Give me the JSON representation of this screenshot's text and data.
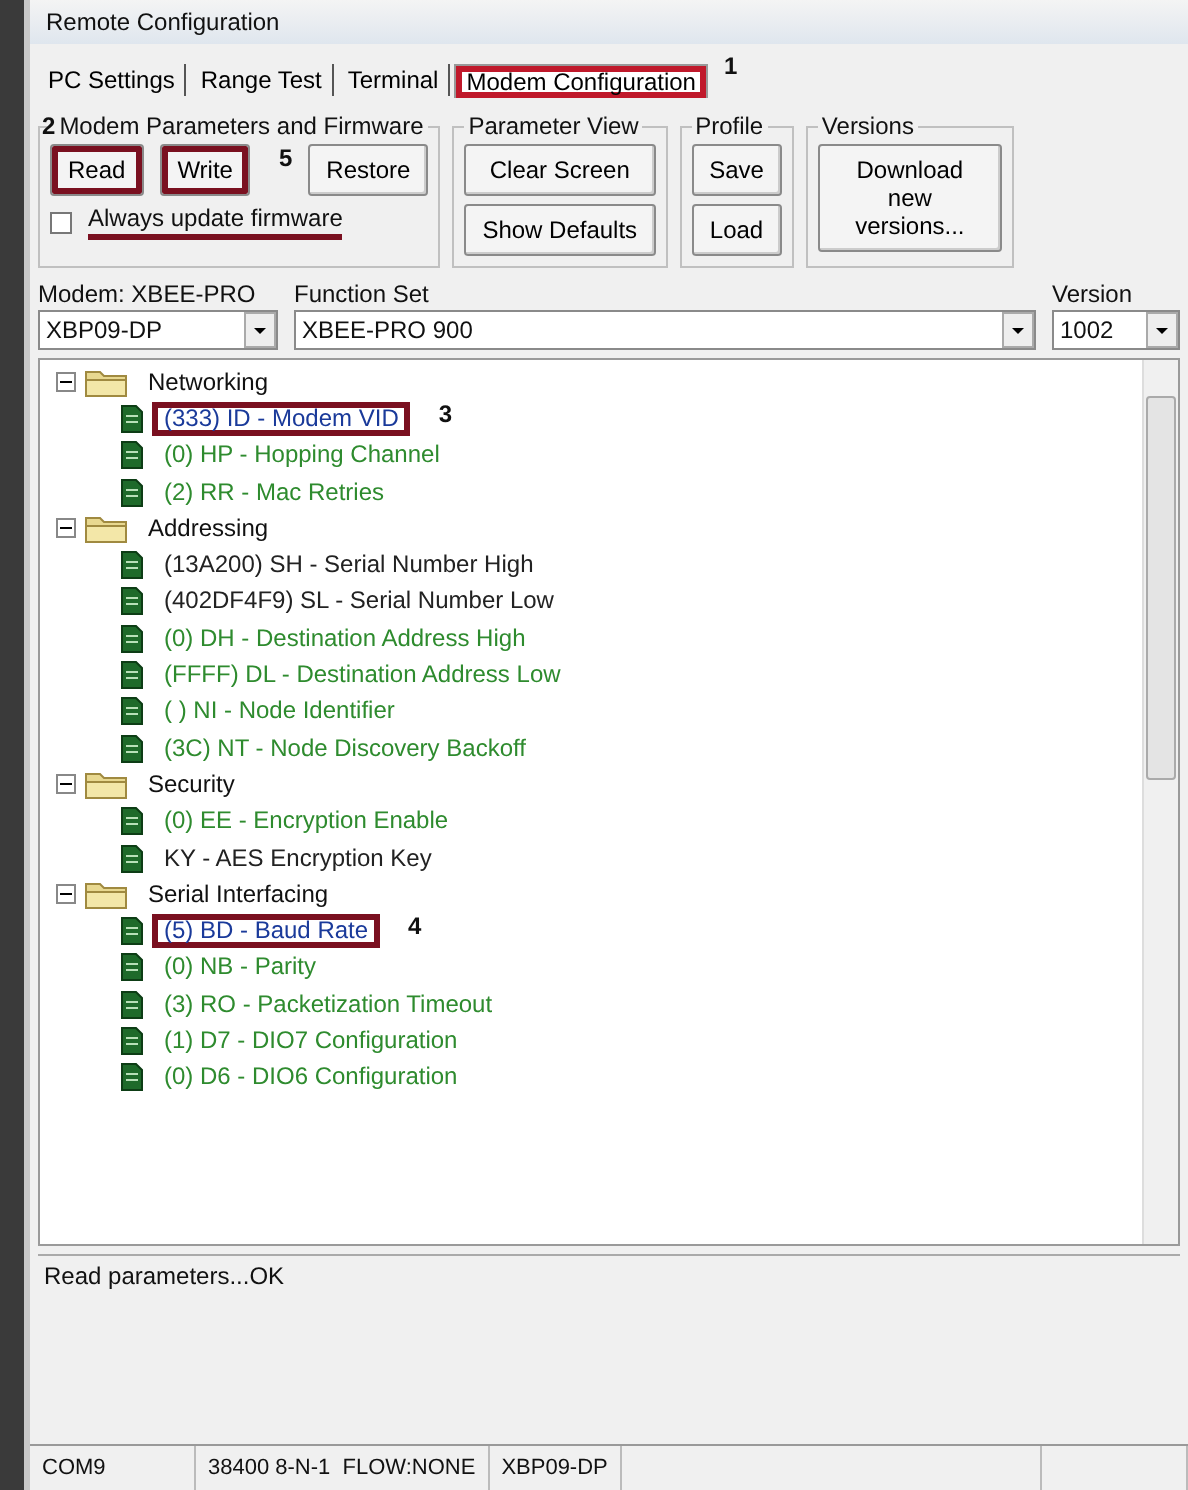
{
  "window": {
    "title": "Remote Configuration"
  },
  "tabs": [
    {
      "label": "PC Settings",
      "selected": false,
      "annotated": false
    },
    {
      "label": "Range Test",
      "selected": false,
      "annotated": false
    },
    {
      "label": "Terminal",
      "selected": false,
      "annotated": false
    },
    {
      "label": "Modem Configuration",
      "selected": true,
      "annotated": true,
      "note": "1"
    }
  ],
  "groups": [
    {
      "title": "Modem Parameters and Firmware",
      "note": "2",
      "buttons": [
        {
          "label": "Read",
          "annotated": true
        },
        {
          "label": "Write",
          "annotated": true,
          "note": "5"
        },
        {
          "label": "Restore",
          "annotated": false
        }
      ],
      "checkbox": {
        "label": "Always update firmware",
        "checked": false,
        "annotated": true
      }
    },
    {
      "title": "Parameter View",
      "buttons": [
        {
          "label": "Clear Screen",
          "annotated": false
        },
        {
          "label": "Show Defaults",
          "annotated": false
        }
      ]
    },
    {
      "title": "Profile",
      "buttons": [
        {
          "label": "Save",
          "annotated": false
        },
        {
          "label": "Load",
          "annotated": false
        }
      ]
    },
    {
      "title": "Versions",
      "buttons": [
        {
          "label": "Download new versions...",
          "annotated": false
        }
      ]
    }
  ],
  "selectors": [
    {
      "label": "Modem: XBEE-PRO",
      "value": "XBP09-DP"
    },
    {
      "label": "Function Set",
      "value": "XBEE-PRO 900"
    },
    {
      "label": "Version",
      "value": "1002"
    }
  ],
  "tree": [
    {
      "label": "Networking",
      "expanded": true,
      "children": [
        {
          "label": "(333) ID - Modem VID",
          "color": "#1a3a9a",
          "annotated": true,
          "note": "3"
        },
        {
          "label": "(0) HP - Hopping Channel",
          "color": "#2e8b2e",
          "annotated": false
        },
        {
          "label": "(2) RR - Mac Retries",
          "color": "#2e8b2e",
          "annotated": false
        }
      ]
    },
    {
      "label": "Addressing",
      "expanded": true,
      "children": [
        {
          "label": "(13A200) SH - Serial Number High",
          "color": "#222222",
          "annotated": false
        },
        {
          "label": "(402DF4F9) SL - Serial Number Low",
          "color": "#222222",
          "annotated": false
        },
        {
          "label": "(0) DH - Destination Address High",
          "color": "#2e8b2e",
          "annotated": false
        },
        {
          "label": "(FFFF) DL - Destination Address Low",
          "color": "#2e8b2e",
          "annotated": false
        },
        {
          "label": "( ) NI - Node Identifier",
          "color": "#2e8b2e",
          "annotated": false
        },
        {
          "label": "(3C) NT - Node Discovery Backoff",
          "color": "#2e8b2e",
          "annotated": false
        }
      ]
    },
    {
      "label": "Security",
      "expanded": true,
      "children": [
        {
          "label": "(0) EE - Encryption Enable",
          "color": "#2e8b2e",
          "annotated": false
        },
        {
          "label": "KY - AES Encryption Key",
          "color": "#222222",
          "annotated": false
        }
      ]
    },
    {
      "label": "Serial Interfacing",
      "expanded": true,
      "children": [
        {
          "label": "(5) BD - Baud Rate",
          "color": "#1a3a9a",
          "annotated": true,
          "note": "4"
        },
        {
          "label": "(0) NB - Parity",
          "color": "#2e8b2e",
          "annotated": false
        },
        {
          "label": "(3) RO - Packetization Timeout",
          "color": "#2e8b2e",
          "annotated": false
        },
        {
          "label": "(1) D7 - DIO7 Configuration",
          "color": "#2e8b2e",
          "annotated": false
        },
        {
          "label": "(0) D6 - DIO6 Configuration",
          "color": "#2e8b2e",
          "annotated": false
        }
      ]
    }
  ],
  "message": "Read parameters...OK",
  "status_bar": [
    "COM9",
    "38400 8-N-1  FLOW:NONE",
    "XBP09-DP"
  ]
}
